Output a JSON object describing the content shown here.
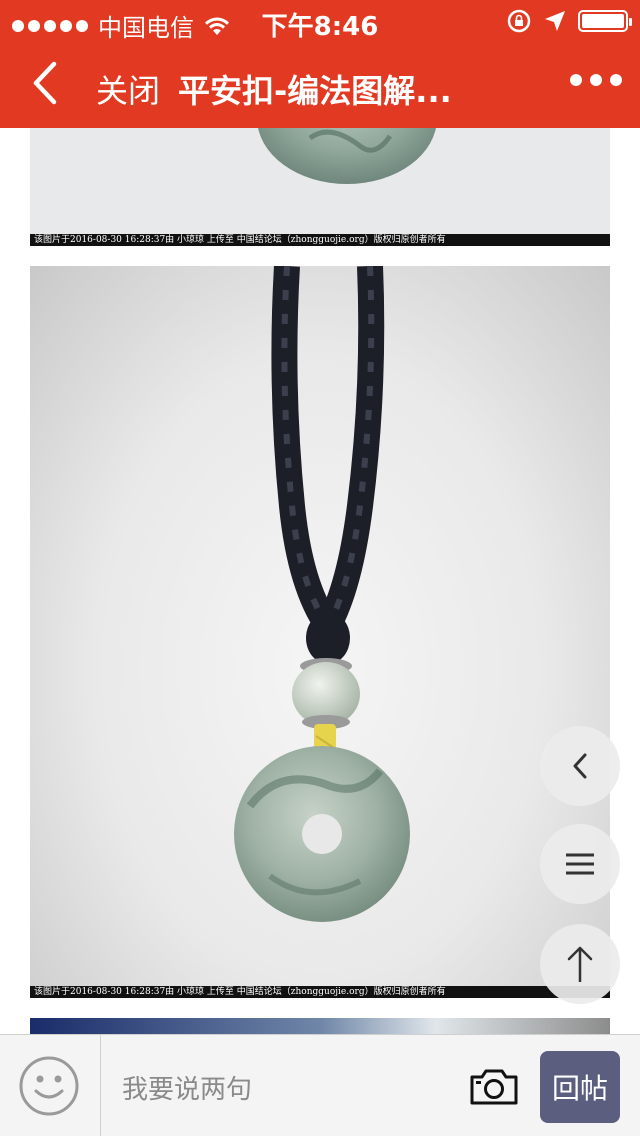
{
  "status_bar": {
    "carrier": "中国电信",
    "time": "下午8:46"
  },
  "nav": {
    "close_label": "关闭",
    "title": "平安扣-编法图解..."
  },
  "images": [
    {
      "caption": "该图片于2016-08-30 16:28:37由 小琼琼 上传至 中国结论坛（zhongguojie.org）版权归原创者所有"
    },
    {
      "caption": "该图片于2016-08-30 16:28:37由 小琼琼 上传至 中国结论坛（zhongguojie.org）版权归原创者所有"
    }
  ],
  "bottom_bar": {
    "input_placeholder": "我要说两句",
    "post_label": "回帖"
  },
  "colors": {
    "header_red": "#e23a22",
    "post_button": "#5c5e80"
  }
}
